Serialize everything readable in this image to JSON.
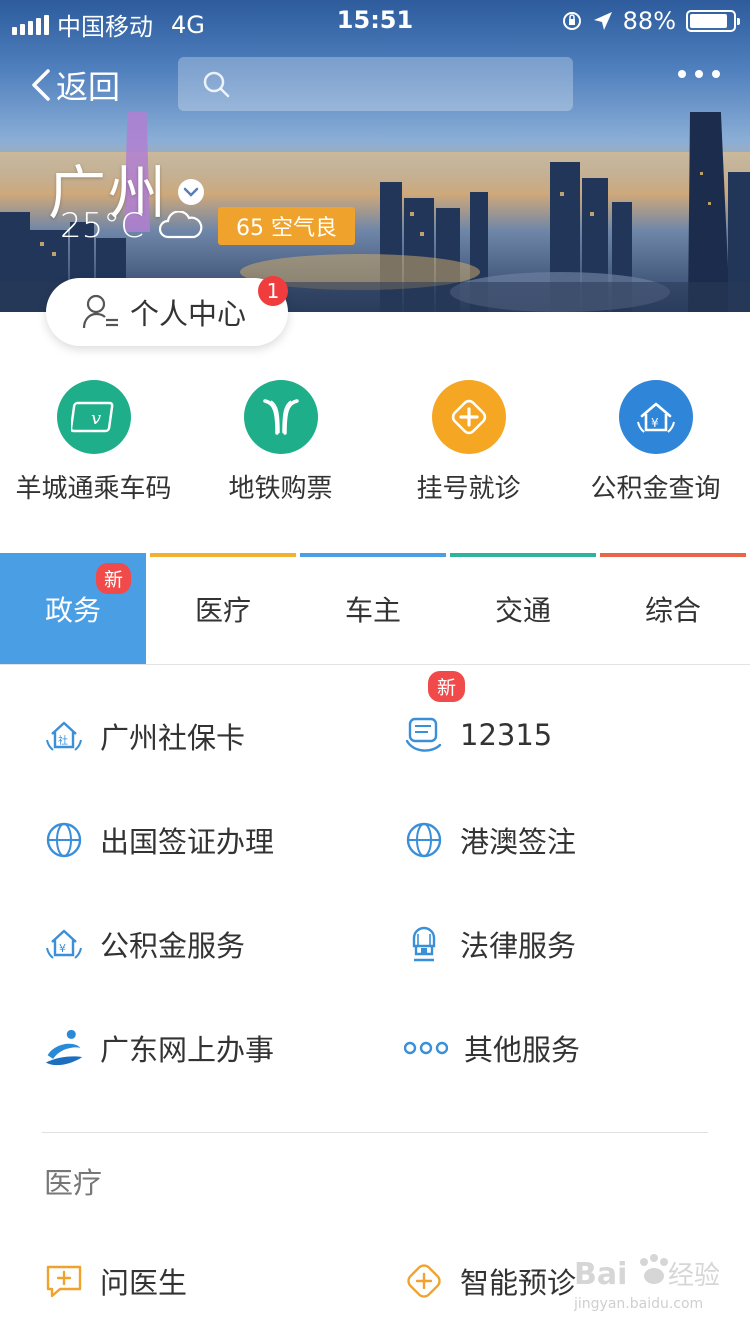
{
  "status_bar": {
    "carrier": "中国移动",
    "network": "4G",
    "time": "15:51",
    "battery": "88%",
    "battery_level": 0.88
  },
  "nav": {
    "back_label": "返回",
    "search_placeholder": ""
  },
  "city": {
    "name": "广州",
    "temperature": "25°C",
    "air_quality": "65 空气良"
  },
  "personal_center": {
    "label": "个人中心",
    "badge": "1"
  },
  "quick_services": [
    {
      "label": "羊城通乘车码",
      "icon": "yct-card-icon",
      "color": "#1fae8a"
    },
    {
      "label": "地铁购票",
      "icon": "metro-icon",
      "color": "#1fae8a"
    },
    {
      "label": "挂号就诊",
      "icon": "medical-cross-icon",
      "color": "#f5a623"
    },
    {
      "label": "公积金查询",
      "icon": "housing-fund-icon",
      "color": "#2f86d8"
    }
  ],
  "tabs": [
    {
      "label": "政务",
      "active": true,
      "badge": "新",
      "color": "#4a9fe4"
    },
    {
      "label": "医疗",
      "color": "#f0b030"
    },
    {
      "label": "车主",
      "color": "#4a9fe4"
    },
    {
      "label": "交通",
      "color": "#2fb49a"
    },
    {
      "label": "综合",
      "color": "#e8654a"
    }
  ],
  "services": [
    {
      "label": "广州社保卡",
      "icon": "social-security-icon"
    },
    {
      "label": "12315",
      "icon": "consumer-hotline-icon",
      "badge": "新"
    },
    {
      "label": "出国签证办理",
      "icon": "globe-icon"
    },
    {
      "label": "港澳签注",
      "icon": "globe-icon"
    },
    {
      "label": "公积金服务",
      "icon": "housing-fund-icon"
    },
    {
      "label": "法律服务",
      "icon": "judge-icon"
    },
    {
      "label": "广东网上办事",
      "icon": "guangdong-logo-icon"
    },
    {
      "label": "其他服务",
      "icon": "more-dots-icon"
    }
  ],
  "medical_section": {
    "title": "医疗",
    "items": [
      {
        "label": "问医生",
        "icon": "chat-doctor-icon"
      },
      {
        "label": "智能预诊",
        "icon": "smart-diagnosis-icon"
      }
    ]
  },
  "colors": {
    "accent_blue": "#4a9fe4",
    "badge_red": "#f04a4a",
    "aqi_orange": "#f0a32c",
    "icon_blue": "#3a8fd9"
  }
}
